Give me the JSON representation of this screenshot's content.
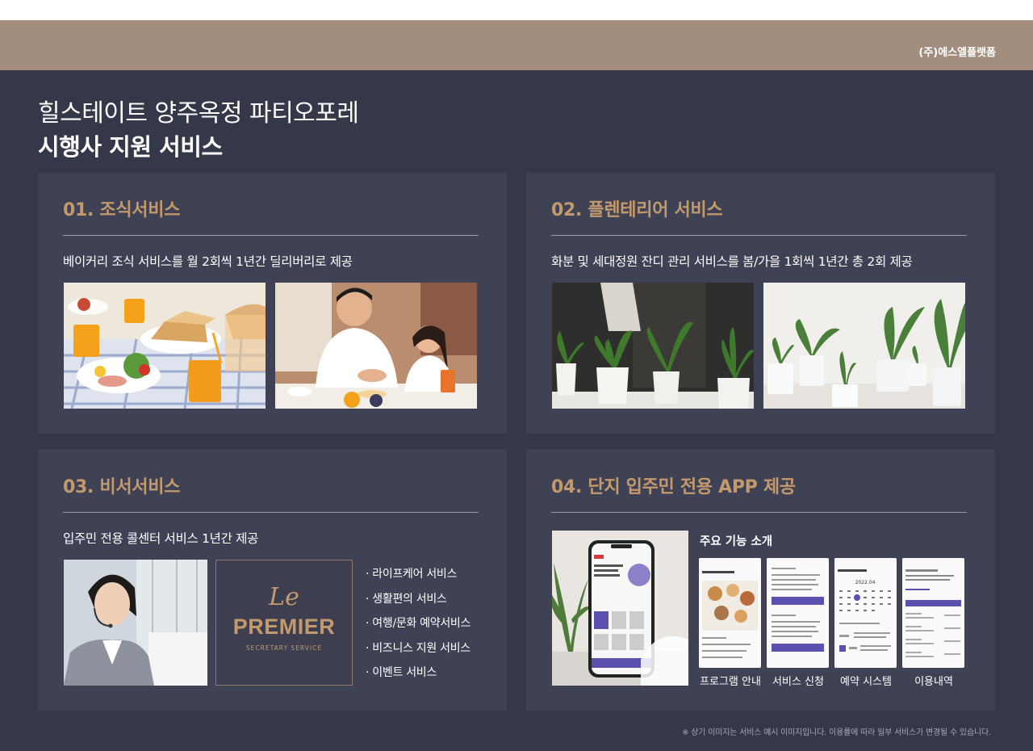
{
  "header": {
    "company": "(주)에스엘플랫폼"
  },
  "title": {
    "line1": "힐스테이트 양주옥정 파티오포레",
    "line2": "시행사 지원 서비스"
  },
  "cards": [
    {
      "title": "01.  조식서비스",
      "desc": "베이커리 조식 서비스를 월 2회씩 1년간 딜리버리로 제공"
    },
    {
      "title": "02. 플렌테리어 서비스",
      "desc": "화분 및 세대정원 잔디 관리 서비스를 봄/가을 1회씩 1년간 총 2회 제공"
    },
    {
      "title": "03. 비서서비스",
      "desc": "입주민 전용 콜센터 서비스 1년간 제공",
      "logo": {
        "script": "Le",
        "main": "PREMIER",
        "sub": "SECRETARY SERVICE"
      },
      "services": [
        "· 라이프케어 서비스",
        "· 생활편의 서비스",
        "· 여행/문화 예약서비스",
        "· 비즈니스 지원 서비스",
        "· 이벤트 서비스"
      ]
    },
    {
      "title": "04. 단지 입주민 전용 APP 제공",
      "feature_heading": "주요 기능 소개",
      "screens": [
        "프로그램 안내",
        "서비스 신청",
        "예약 시스템",
        "이용내역"
      ],
      "calendar_month": "2022.04"
    }
  ],
  "footnote": "※ 상기 이미지는 서비스 예시 이미지입니다. 이용률에 따라 일부 서비스가 변경될 수 있습니다.",
  "colors": {
    "background": "#353849",
    "card": "#3f4255",
    "accent": "#c49a6c",
    "band": "#a28d7e",
    "app_purple": "#5b4fb0"
  }
}
